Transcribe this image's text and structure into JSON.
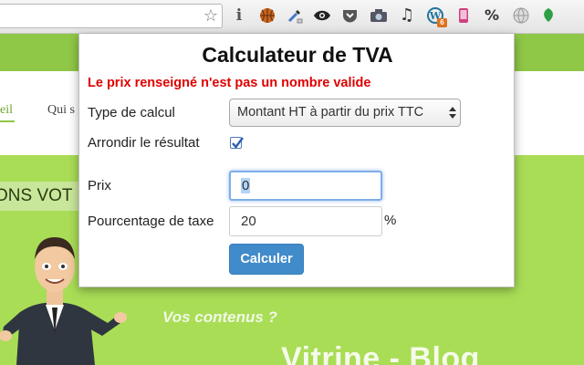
{
  "browser": {
    "toolbar_icons": [
      "bookmark-star-icon",
      "info-icon",
      "basketball-icon",
      "eyedropper-icon",
      "eye-icon",
      "pocket-icon",
      "camera-icon",
      "music-note-icon",
      "wordpress-icon",
      "phone-icon",
      "percent-icon",
      "globe-icon",
      "green-leaf-icon"
    ],
    "percent_glyph": "%",
    "wordpress_badge": "6",
    "info_glyph": "i"
  },
  "background_page": {
    "nav_item_1": "eil",
    "nav_item_2": "Qui s",
    "banner_text": "ONS VOT",
    "tagline": "Vos contenus ?",
    "headline": "Vitrine - Blog",
    "colors": {
      "header_band": "#8fc747",
      "body": "#a9dd56"
    }
  },
  "popup": {
    "title": "Calculateur de TVA",
    "error_message": "Le prix renseigné n'est pas un nombre valide",
    "type_label": "Type de calcul",
    "type_selected": "Montant HT à partir du prix TTC",
    "round_label": "Arrondir le résultat",
    "round_checked": true,
    "price_label": "Prix",
    "price_value": "0",
    "tax_label": "Pourcentage de taxe",
    "tax_value": "20",
    "percent_suffix": "%",
    "submit_label": "Calculer",
    "colors": {
      "error": "#e00000",
      "button": "#428bca"
    }
  }
}
